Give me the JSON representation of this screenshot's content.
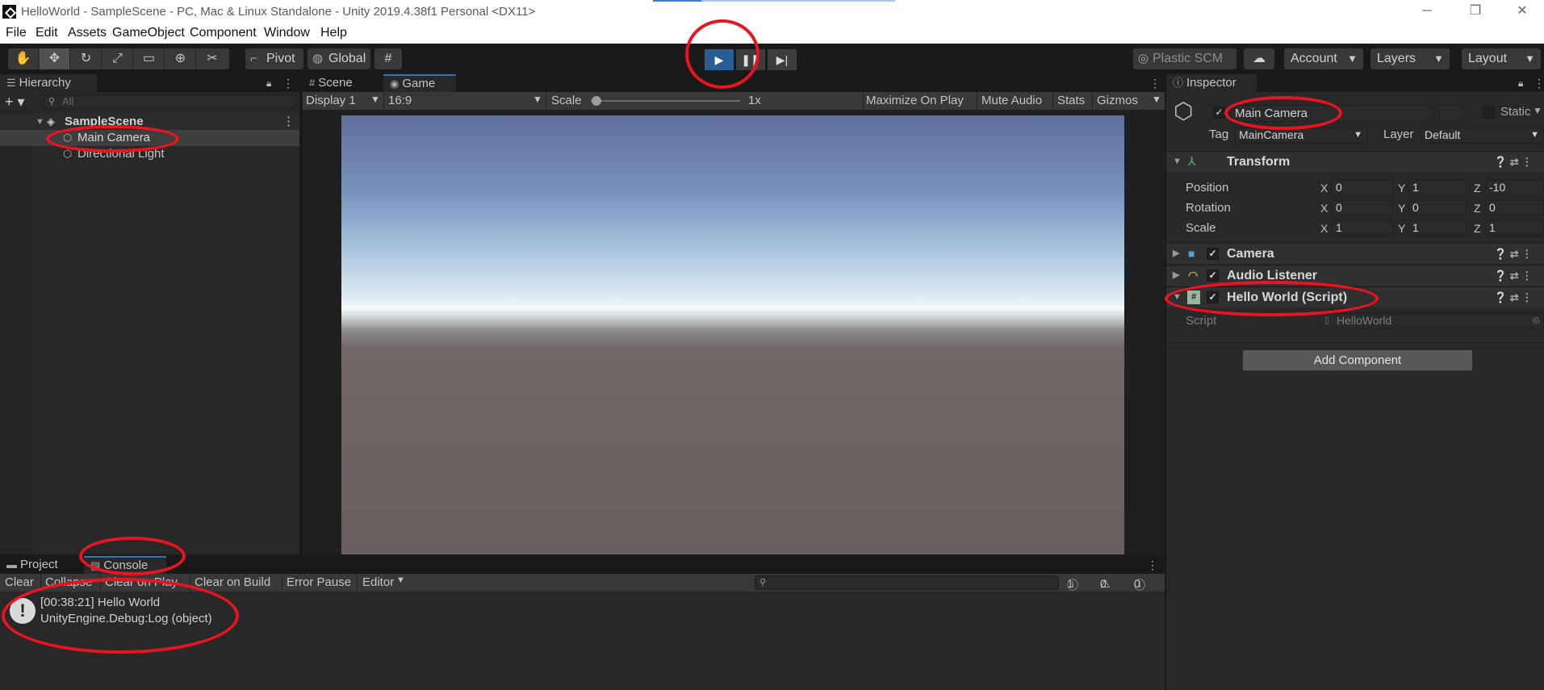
{
  "window": {
    "title": "HelloWorld - SampleScene - PC, Mac & Linux Standalone - Unity 2019.4.38f1 Personal <DX11>",
    "minimize": "─",
    "restore": "❐",
    "close": "✕"
  },
  "menu": [
    "File",
    "Edit",
    "Assets",
    "GameObject",
    "Component",
    "Window",
    "Help"
  ],
  "toolbar": {
    "pivot_label": "Pivot",
    "global_label": "Global",
    "plastic_scm": "Plastic SCM",
    "account": "Account",
    "layers": "Layers",
    "layout": "Layout"
  },
  "hierarchy": {
    "tab": "Hierarchy",
    "search_placeholder": "All",
    "scene": "SampleScene",
    "items": [
      "Main Camera",
      "Directional Light"
    ]
  },
  "center": {
    "tabs": [
      "Scene",
      "Game"
    ],
    "display": "Display 1",
    "aspect": "16:9",
    "scale_label": "Scale",
    "scale_value": "1x",
    "maximize_on_play": "Maximize On Play",
    "mute_audio": "Mute Audio",
    "stats": "Stats",
    "gizmos": "Gizmos"
  },
  "inspector": {
    "tab": "Inspector",
    "object_name": "Main Camera",
    "static_label": "Static",
    "tag_label": "Tag",
    "tag_value": "MainCamera",
    "layer_label": "Layer",
    "layer_value": "Default",
    "transform": {
      "title": "Transform",
      "rows": [
        {
          "label": "Position",
          "x": "0",
          "y": "1",
          "z": "-10"
        },
        {
          "label": "Rotation",
          "x": "0",
          "y": "0",
          "z": "0"
        },
        {
          "label": "Scale",
          "x": "1",
          "y": "1",
          "z": "1"
        }
      ]
    },
    "components": [
      "Camera",
      "Audio Listener",
      "Hello World (Script)"
    ],
    "script_label": "Script",
    "script_value": "HelloWorld",
    "add_component": "Add Component"
  },
  "bottom": {
    "tabs": [
      "Project",
      "Console"
    ],
    "clear": "Clear",
    "collapse": "Collapse",
    "clear_on_play": "Clear on Play",
    "clear_on_build": "Clear on Build",
    "error_pause": "Error Pause",
    "editor": "Editor",
    "error_count": "1",
    "warning_count": "0",
    "info_count": "0",
    "log_line1": "[00:38:21] Hello World",
    "log_line2": "UnityEngine.Debug:Log (object)"
  },
  "colors": {
    "annotation": "#e8141e",
    "play_active": "#2a5d93",
    "tab_accent": "#3a72b0"
  }
}
